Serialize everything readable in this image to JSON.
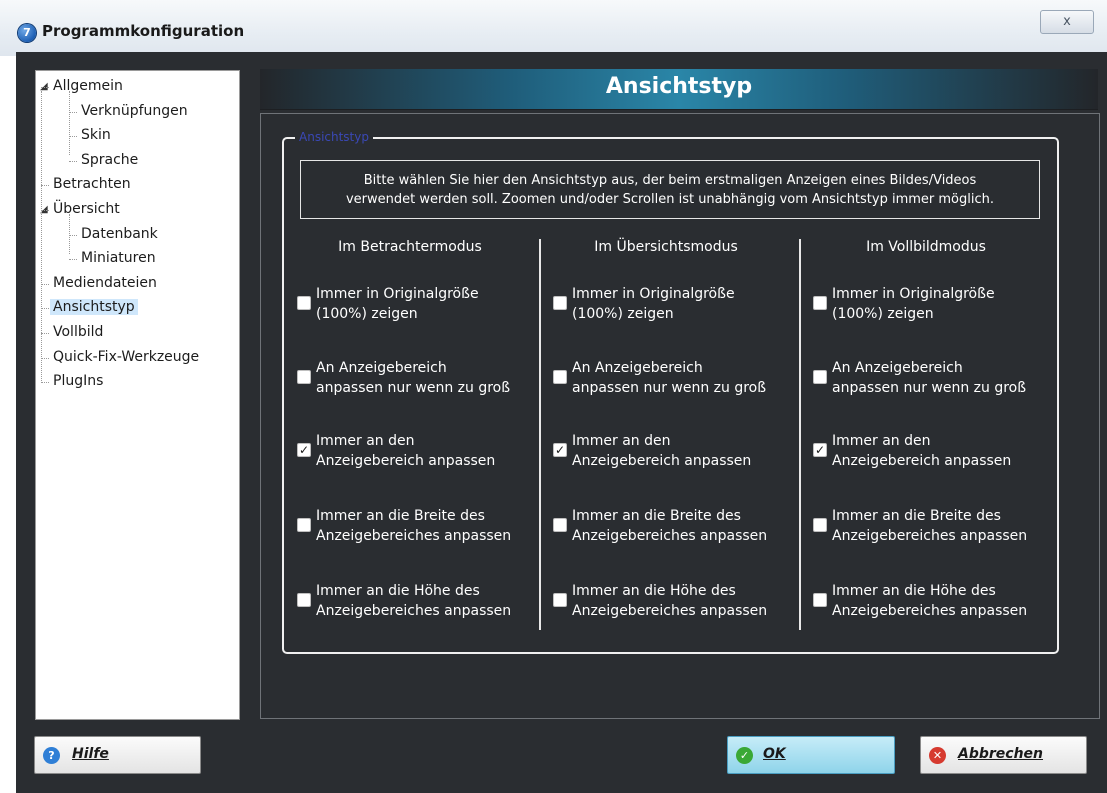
{
  "window": {
    "title": "Programmkonfiguration",
    "close_glyph": "x"
  },
  "tree": {
    "items": [
      {
        "label": "Allgemein",
        "level": 0,
        "expanded": true
      },
      {
        "label": "Verknüpfungen",
        "level": 1
      },
      {
        "label": "Skin",
        "level": 1
      },
      {
        "label": "Sprache",
        "level": 1
      },
      {
        "label": "Betrachten",
        "level": 0
      },
      {
        "label": "Übersicht",
        "level": 0,
        "expanded": true
      },
      {
        "label": "Datenbank",
        "level": 1
      },
      {
        "label": "Miniaturen",
        "level": 1
      },
      {
        "label": "Mediendateien",
        "level": 0
      },
      {
        "label": "Ansichtstyp",
        "level": 0,
        "selected": true
      },
      {
        "label": "Vollbild",
        "level": 0
      },
      {
        "label": "Quick-Fix-Werkzeuge",
        "level": 0
      },
      {
        "label": "PlugIns",
        "level": 0
      }
    ]
  },
  "page": {
    "header": "Ansichtstyp",
    "group_legend": "Ansichtstyp",
    "info_line1": "Bitte wählen Sie hier den Ansichtstyp aus, der beim erstmaligen Anzeigen eines Bildes/Videos",
    "info_line2": "verwendet werden soll. Zoomen und/oder Scrollen ist unabhängig vom Ansichtstyp immer möglich."
  },
  "columns": [
    {
      "title": "Im Betrachtermodus"
    },
    {
      "title": "Im Übersichtsmodus"
    },
    {
      "title": "Im Vollbildmodus"
    }
  ],
  "options": [
    {
      "line1": "Immer in Originalgröße",
      "line2": "(100%) zeigen",
      "checked": false
    },
    {
      "line1": "An Anzeigebereich",
      "line2": "anpassen nur wenn zu groß",
      "checked": false
    },
    {
      "line1": "Immer an den",
      "line2": "Anzeigebereich anpassen",
      "checked": true
    },
    {
      "line1": "Immer an die Breite des",
      "line2": "Anzeigebereiches anpassen",
      "checked": false
    },
    {
      "line1": "Immer an die Höhe des",
      "line2": "Anzeigebereiches anpassen",
      "checked": false
    }
  ],
  "buttons": {
    "help": {
      "label": "Hilfe",
      "icon": "help-icon"
    },
    "ok": {
      "label": "OK",
      "icon": "check-icon"
    },
    "cancel": {
      "label": "Abbrechen",
      "icon": "cancel-icon"
    }
  },
  "colors": {
    "background": "#2a2d31",
    "header_accent": "#2a86a8",
    "legend": "#3a48b5",
    "help_icon": "#2f7fd6",
    "ok_icon": "#3aa835",
    "cancel_icon": "#d63a2f"
  }
}
